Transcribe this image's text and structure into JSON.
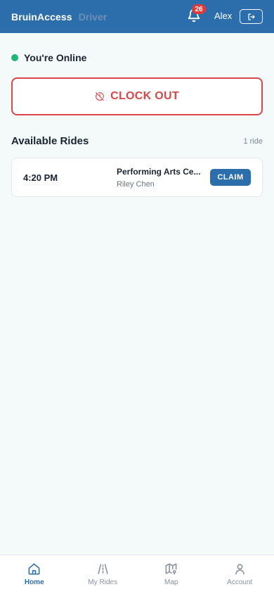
{
  "header": {
    "brand": "BruinAccess",
    "brand_sub": "Driver",
    "notification_count": "26",
    "user_name": "Alex",
    "bar_color": "#2c6eab",
    "logout_icon": "logout-icon"
  },
  "status": {
    "text": "You're Online",
    "dot_color": "#22b573"
  },
  "clock_out": {
    "label": "CLOCK OUT",
    "icon": "clock-off-icon",
    "color": "#d94848"
  },
  "rides": {
    "title": "Available Rides",
    "count_label": "1 ride",
    "items": [
      {
        "time": "4:20 PM",
        "destination": "Performing Arts Ce...",
        "rider": "Riley Chen",
        "action_label": "CLAIM"
      }
    ]
  },
  "nav": {
    "items": [
      {
        "label": "Home",
        "icon": "home-icon",
        "active": true
      },
      {
        "label": "My Rides",
        "icon": "road-icon",
        "active": false
      },
      {
        "label": "Map",
        "icon": "map-icon",
        "active": false
      },
      {
        "label": "Account",
        "icon": "user-icon",
        "active": false
      }
    ]
  }
}
